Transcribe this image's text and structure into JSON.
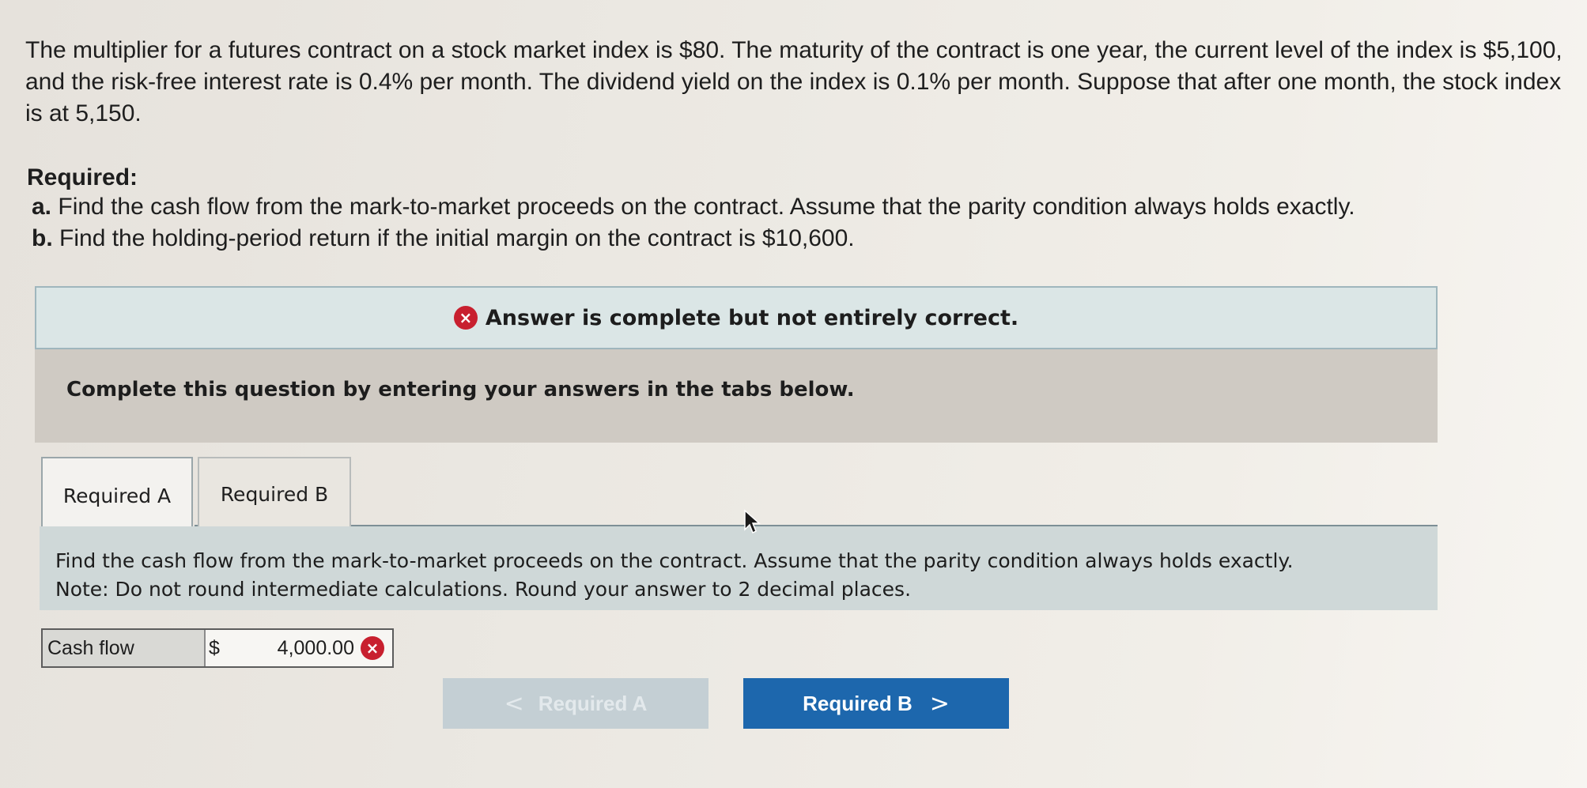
{
  "problem": {
    "text": "The multiplier for a futures contract on a stock market index is $80. The maturity of the contract is one year, the current level of the index is $5,100, and the risk-free interest rate is 0.4% per month. The dividend yield on the index is 0.1% per month. Suppose that after one month, the stock index is at 5,150."
  },
  "required": {
    "heading": "Required:",
    "items": [
      {
        "marker": "a.",
        "text": "Find the cash flow from the mark-to-market proceeds on the contract. Assume that the parity condition always holds exactly."
      },
      {
        "marker": "b.",
        "text": "Find the holding-period return if the initial margin on the contract is $10,600."
      }
    ]
  },
  "feedback": {
    "message": "Answer is complete but not entirely correct."
  },
  "instructions": {
    "text": "Complete this question by entering your answers in the tabs below."
  },
  "tabs": [
    {
      "label": "Required A"
    },
    {
      "label": "Required B"
    }
  ],
  "question": {
    "line1": "Find the cash flow from the mark-to-market proceeds on the contract. Assume that the parity condition always holds exactly.",
    "line2": "Note: Do not round intermediate calculations. Round your answer to 2 decimal places."
  },
  "answer": {
    "label": "Cash flow",
    "currency": "$",
    "value": "4,000.00"
  },
  "nav": {
    "prev_label": "Required A",
    "next_label": "Required B",
    "prev_chevron": "<",
    "next_chevron": ">"
  },
  "icons": {
    "incorrect": "x-circle-icon",
    "incorrect_glyph": "×"
  },
  "colors": {
    "incorrect_red": "#c8202f",
    "primary_blue": "#1d67ad",
    "disabled_button": "#c4cfd4"
  }
}
